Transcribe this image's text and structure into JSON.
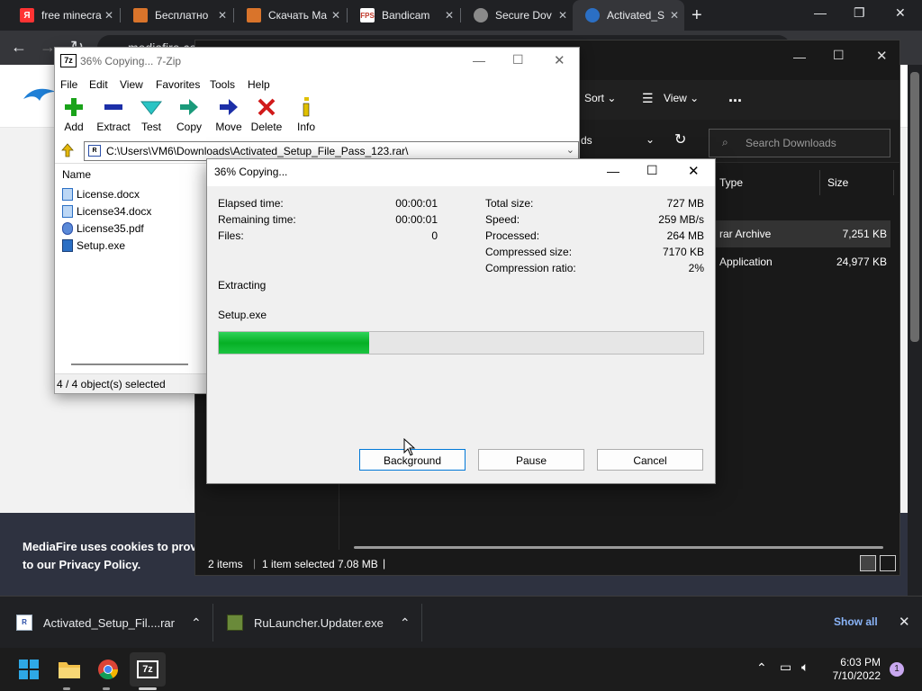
{
  "browser": {
    "tabs": [
      {
        "label": "free minecra",
        "icon": "yandex-icon",
        "color": "#ff3333"
      },
      {
        "label": "Бесплатно",
        "icon": "cube-icon",
        "color": "#d9742b"
      },
      {
        "label": "Скачать Ma",
        "icon": "cube-icon",
        "color": "#d9742b"
      },
      {
        "label": "Bandicam",
        "icon": "bandicam-icon",
        "color": "#c0392b"
      },
      {
        "label": "Secure Dov",
        "icon": "globe-icon",
        "color": "#8a8a8a"
      },
      {
        "label": "Activated_S",
        "icon": "mediafire-icon",
        "color": "#2b6fc4"
      }
    ],
    "url": "mediafire.co"
  },
  "page": {
    "cookie_line1": "MediaFire uses cookies to provid",
    "cookie_line2_prefix": "to our ",
    "cookie_line2_link": "Privacy Policy",
    "cookie_line2_suffix": "."
  },
  "explorer": {
    "sort_label": "Sort",
    "view_label": "View",
    "more_label": "...",
    "address_tail": "ds",
    "search_placeholder": "Search Downloads",
    "col_type": "Type",
    "col_size": "Size",
    "files": [
      {
        "type": "rar Archive",
        "size": "7,251 KB",
        "selected": true
      },
      {
        "type": "Application",
        "size": "24,977 KB",
        "selected": false
      }
    ],
    "status_items": "2 items",
    "status_selected": "1 item selected  7.08 MB"
  },
  "zip": {
    "title": "36% Copying... 7-Zip",
    "logo": "7z",
    "menu": [
      "File",
      "Edit",
      "View",
      "Favorites",
      "Tools",
      "Help"
    ],
    "tools": [
      "Add",
      "Extract",
      "Test",
      "Copy",
      "Move",
      "Delete",
      "Info"
    ],
    "path": "C:\\Users\\VM6\\Downloads\\Activated_Setup_File_Pass_123.rar\\",
    "col_name": "Name",
    "files": [
      "License.docx",
      "License34.docx",
      "License35.pdf",
      "Setup.exe"
    ],
    "status": "4 / 4 object(s) selected"
  },
  "dialog": {
    "title": "36% Copying...",
    "elapsed_label": "Elapsed time:",
    "elapsed_value": "00:00:01",
    "remaining_label": "Remaining time:",
    "remaining_value": "00:00:01",
    "files_label": "Files:",
    "files_value": "0",
    "total_label": "Total size:",
    "total_value": "727 MB",
    "speed_label": "Speed:",
    "speed_value": "259 MB/s",
    "processed_label": "Processed:",
    "processed_value": "264 MB",
    "compressed_label": "Compressed size:",
    "compressed_value": "7170 KB",
    "ratio_label": "Compression ratio:",
    "ratio_value": "2%",
    "action": "Extracting",
    "current_file": "Setup.exe",
    "progress": 0.31,
    "btn_background": "Background",
    "btn_pause": "Pause",
    "btn_cancel": "Cancel"
  },
  "downloads": {
    "item1": "Activated_Setup_Fil....rar",
    "item2": "RuLauncher.Updater.exe",
    "show_all": "Show all"
  },
  "taskbar": {
    "time": "6:03 PM",
    "date": "7/10/2022",
    "notif_count": "1",
    "apps": [
      "start-icon",
      "file-explorer-icon",
      "chrome-icon",
      "7zip-icon"
    ]
  }
}
